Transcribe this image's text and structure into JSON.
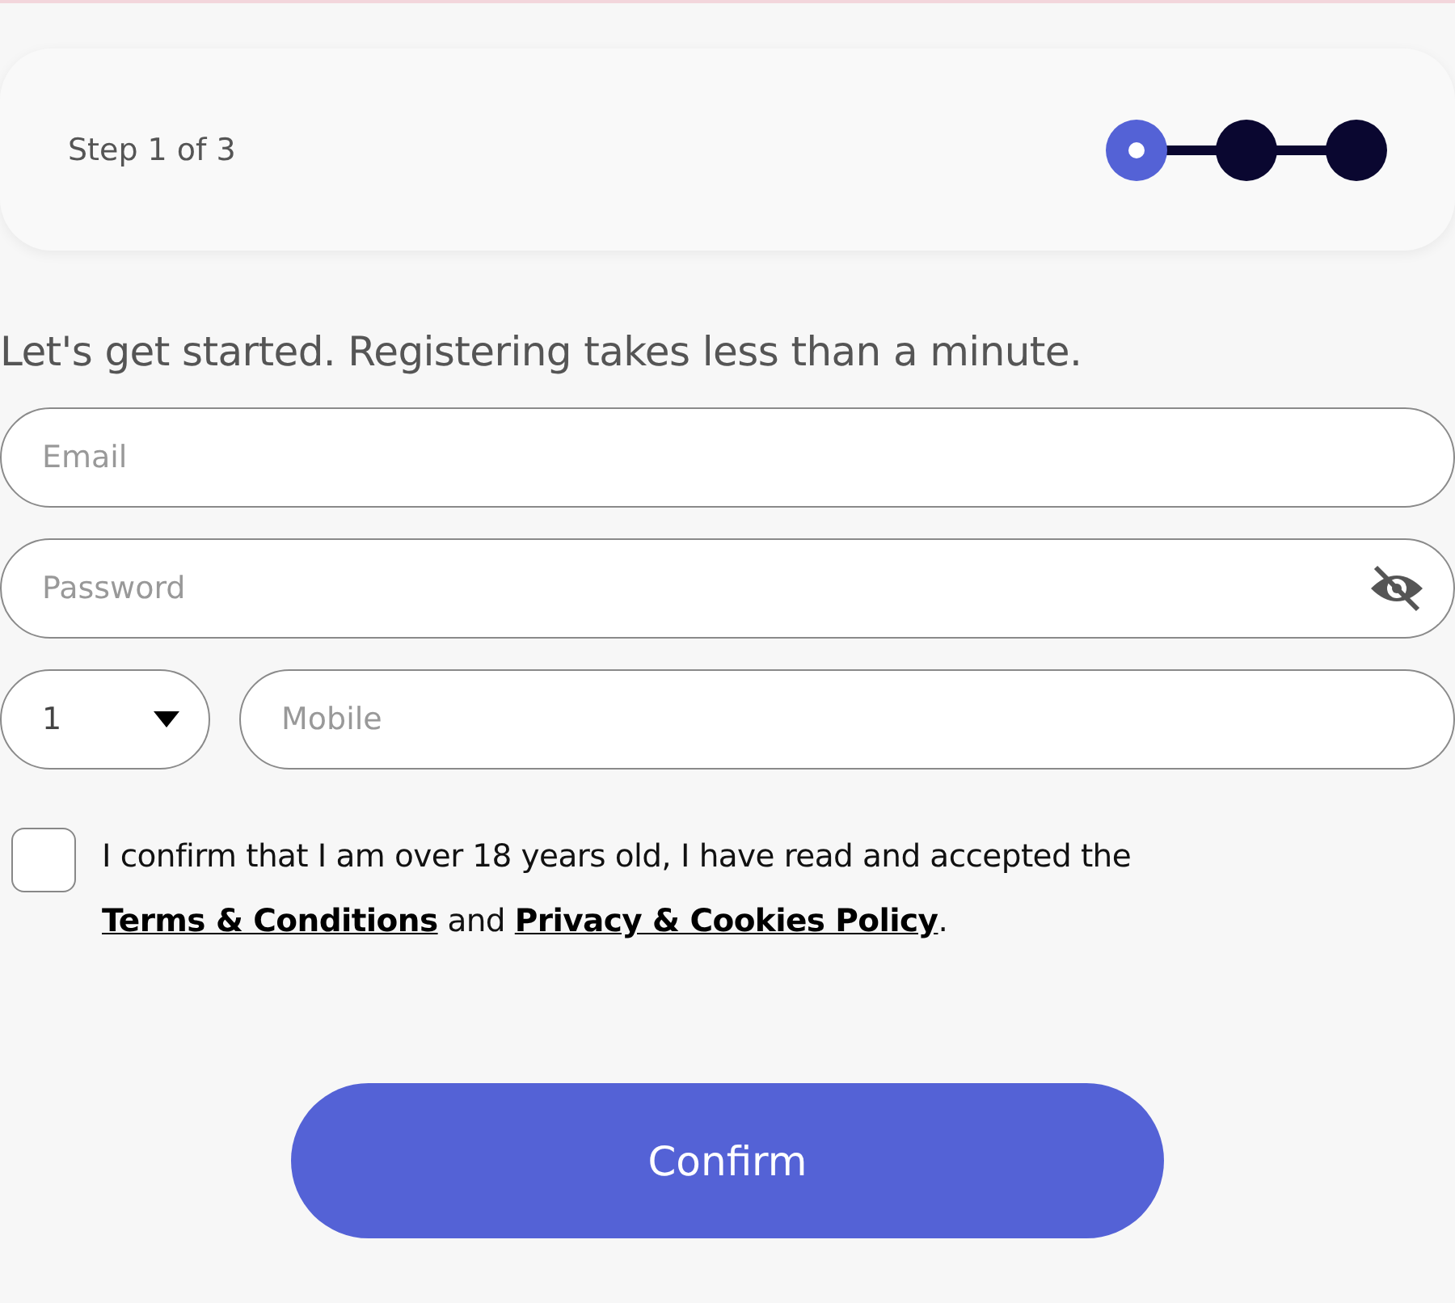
{
  "progress": {
    "label": "Step 1 of 3",
    "steps": [
      {
        "selected": true
      },
      {
        "selected": false
      },
      {
        "selected": false
      }
    ]
  },
  "intro": "Let's get started. Registering takes less than a minute.",
  "email": {
    "placeholder": "Email"
  },
  "password": {
    "placeholder": "Password",
    "visible": false
  },
  "phone": {
    "country_code": "1",
    "placeholder": "Mobile"
  },
  "consent": {
    "checked": false,
    "parts": [
      {
        "kind": "text",
        "text": "I confirm that I am over 18 years old, I have read and accepted the "
      },
      {
        "kind": "link",
        "text": "Terms & Conditions"
      },
      {
        "kind": "text",
        "text": " and "
      },
      {
        "kind": "link",
        "text": "Privacy & Cookies Policy"
      },
      {
        "kind": "text",
        "text": "."
      }
    ]
  },
  "submit": "Confirm"
}
